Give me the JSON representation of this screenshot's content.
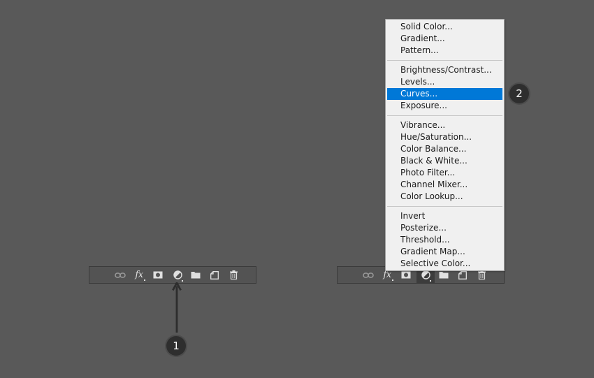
{
  "toolbar_icons": [
    "link-icon",
    "fx-icon",
    "mask-icon",
    "adjustment-icon",
    "folder-icon",
    "new-layer-icon",
    "trash-icon"
  ],
  "toolbar": {
    "fx_label": "fx"
  },
  "menu": {
    "groups": [
      [
        "Solid Color...",
        "Gradient...",
        "Pattern..."
      ],
      [
        "Brightness/Contrast...",
        "Levels...",
        "Curves...",
        "Exposure..."
      ],
      [
        "Vibrance...",
        "Hue/Saturation...",
        "Color Balance...",
        "Black & White...",
        "Photo Filter...",
        "Channel Mixer...",
        "Color Lookup..."
      ],
      [
        "Invert",
        "Posterize...",
        "Threshold...",
        "Gradient Map...",
        "Selective Color..."
      ]
    ],
    "selected": "Curves..."
  },
  "annotations": {
    "step1": "1",
    "step2": "2"
  },
  "colors": {
    "background": "#595959",
    "selection": "#0078d7",
    "menu_bg": "#f0f0f0",
    "badge": "#2e2e2e"
  }
}
